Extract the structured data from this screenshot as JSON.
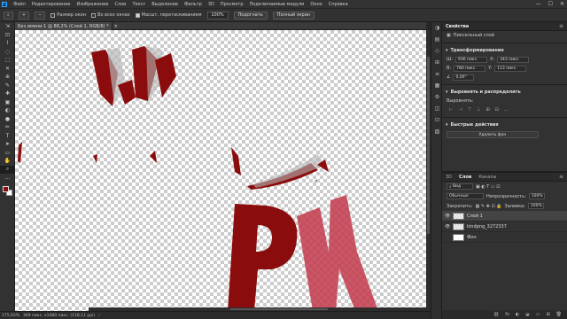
{
  "menu": {
    "logo": "Ps",
    "items": [
      "Файл",
      "Редактирование",
      "Изображение",
      "Слои",
      "Текст",
      "Выделение",
      "Фильтр",
      "3D",
      "Просмотр",
      "Подключаемые модули",
      "Окно",
      "Справка"
    ],
    "window_controls": [
      "—",
      "☐",
      "✕"
    ]
  },
  "options": {
    "tool_icon": "⌕",
    "zoom_in": "+",
    "zoom_out": "−",
    "resize_windows_label": "Размер окон",
    "zoom_all_label": "Во всех окнах",
    "scrubby_label": "Масшт. перетаскиванием",
    "zoom_value": "100%",
    "fit_button": "Подогнать",
    "fill_button": "Полный экран"
  },
  "toolbar": {
    "tools": [
      "⇲",
      "⊡",
      "⌇",
      "◌",
      "⬚",
      "✕",
      "⊕",
      "✎",
      "✚",
      "▣",
      "◐",
      "●",
      "✏",
      "T",
      "➤",
      "▭",
      "✋",
      "⌕",
      "…"
    ]
  },
  "document": {
    "tab_title": "Без имени-1 @ 88,2% (Слой 1, RGB/8) *",
    "tab_close": "×",
    "artwork_text": "PK"
  },
  "status": {
    "zoom": "175,93%",
    "info": "369 пикс. х1080 пикс. (118,11 ppi)",
    "arrow": "›"
  },
  "iconcol": {
    "icons": [
      "◑",
      "▤",
      "◇",
      "⊞",
      "≡",
      "▦",
      "⚙",
      "◫",
      "⊡",
      "▧"
    ]
  },
  "properties": {
    "tab": "Свойства",
    "layer_type": "Пиксельный слой",
    "transform_title": "Трансформирование",
    "w_label": "Ш:",
    "w_value": "936 пикс.",
    "x_label": "X:",
    "x_value": "343 пикс.",
    "h_label": "В:",
    "h_value": "780 пикс.",
    "y_label": "Y:",
    "y_value": "113 пикс.",
    "angle_value": "0,00°",
    "align_title": "Выровнять и распределить",
    "align_label": "Выровнять:",
    "align_icons": [
      "⊢",
      "⊣",
      "⊤",
      "⊥",
      "⊞",
      "⊟"
    ],
    "quick_title": "Быстрые действия",
    "remove_bg_button": "Удалить фон",
    "more": "…"
  },
  "layers": {
    "tabs": [
      "3D",
      "Слои",
      "Каналы"
    ],
    "kind_label": "Вид",
    "blend_mode": "Обычные",
    "opacity_label": "Непрозрачность:",
    "opacity_value": "100%",
    "lock_label": "Закрепить:",
    "fill_label": "Заливка:",
    "fill_value": "100%",
    "items": [
      {
        "name": "Слой 1",
        "thumb": "transparent",
        "visible": true,
        "selected": true
      },
      {
        "name": "kindpng_3272337",
        "thumb": "transparent",
        "visible": true,
        "selected": false
      },
      {
        "name": "Фон",
        "thumb": "white",
        "visible": false,
        "selected": false
      }
    ],
    "footer_icons": [
      "⛓",
      "fx",
      "◐",
      "◒",
      "▭",
      "⊞",
      "🗑"
    ]
  },
  "colors": {
    "accent_red": "#8a0c0c",
    "accent_red_light": "#c23a4b",
    "ui_bg": "#323232"
  }
}
